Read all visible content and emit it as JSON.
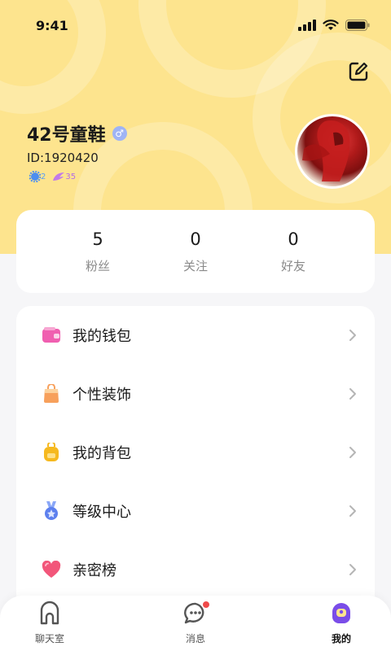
{
  "status_bar": {
    "time": "9:41"
  },
  "profile": {
    "name": "42号童鞋",
    "gender_symbol": "♂",
    "id_text": "ID:1920420",
    "level_badge": "2",
    "wing_badge": "35"
  },
  "stats": [
    {
      "value": "5",
      "label": "粉丝"
    },
    {
      "value": "0",
      "label": "关注"
    },
    {
      "value": "0",
      "label": "好友"
    }
  ],
  "menu": [
    {
      "label": "我的钱包",
      "icon": "wallet-icon"
    },
    {
      "label": "个性装饰",
      "icon": "shopping-bag-icon"
    },
    {
      "label": "我的背包",
      "icon": "backpack-icon"
    },
    {
      "label": "等级中心",
      "icon": "medal-icon"
    },
    {
      "label": "亲密榜",
      "icon": "heart-icon"
    }
  ],
  "bottom_nav": [
    {
      "label": "聊天室",
      "icon": "chatroom-icon",
      "active": false
    },
    {
      "label": "消息",
      "icon": "message-icon",
      "active": false,
      "has_badge": true
    },
    {
      "label": "我的",
      "icon": "me-icon",
      "active": true
    }
  ],
  "colors": {
    "header": "#fde48e",
    "active_nav": "#7a4de8",
    "badge_dot": "#ef4b4b"
  }
}
